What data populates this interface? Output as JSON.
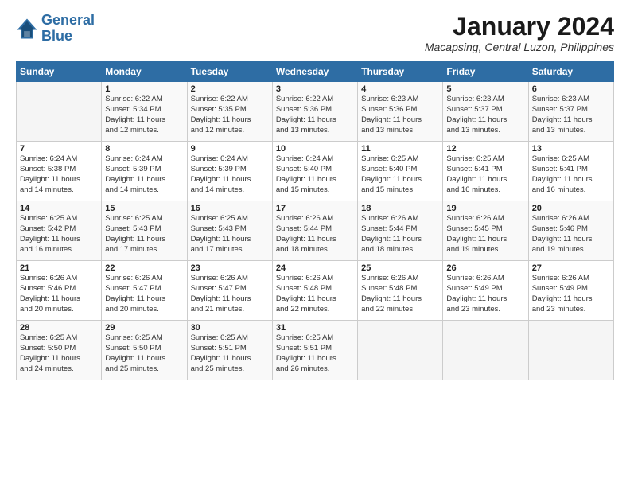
{
  "logo": {
    "line1": "General",
    "line2": "Blue"
  },
  "title": "January 2024",
  "subtitle": "Macapsing, Central Luzon, Philippines",
  "days_header": [
    "Sunday",
    "Monday",
    "Tuesday",
    "Wednesday",
    "Thursday",
    "Friday",
    "Saturday"
  ],
  "weeks": [
    [
      {
        "num": "",
        "info": ""
      },
      {
        "num": "1",
        "info": "Sunrise: 6:22 AM\nSunset: 5:34 PM\nDaylight: 11 hours\nand 12 minutes."
      },
      {
        "num": "2",
        "info": "Sunrise: 6:22 AM\nSunset: 5:35 PM\nDaylight: 11 hours\nand 12 minutes."
      },
      {
        "num": "3",
        "info": "Sunrise: 6:22 AM\nSunset: 5:36 PM\nDaylight: 11 hours\nand 13 minutes."
      },
      {
        "num": "4",
        "info": "Sunrise: 6:23 AM\nSunset: 5:36 PM\nDaylight: 11 hours\nand 13 minutes."
      },
      {
        "num": "5",
        "info": "Sunrise: 6:23 AM\nSunset: 5:37 PM\nDaylight: 11 hours\nand 13 minutes."
      },
      {
        "num": "6",
        "info": "Sunrise: 6:23 AM\nSunset: 5:37 PM\nDaylight: 11 hours\nand 13 minutes."
      }
    ],
    [
      {
        "num": "7",
        "info": "Sunrise: 6:24 AM\nSunset: 5:38 PM\nDaylight: 11 hours\nand 14 minutes."
      },
      {
        "num": "8",
        "info": "Sunrise: 6:24 AM\nSunset: 5:39 PM\nDaylight: 11 hours\nand 14 minutes."
      },
      {
        "num": "9",
        "info": "Sunrise: 6:24 AM\nSunset: 5:39 PM\nDaylight: 11 hours\nand 14 minutes."
      },
      {
        "num": "10",
        "info": "Sunrise: 6:24 AM\nSunset: 5:40 PM\nDaylight: 11 hours\nand 15 minutes."
      },
      {
        "num": "11",
        "info": "Sunrise: 6:25 AM\nSunset: 5:40 PM\nDaylight: 11 hours\nand 15 minutes."
      },
      {
        "num": "12",
        "info": "Sunrise: 6:25 AM\nSunset: 5:41 PM\nDaylight: 11 hours\nand 16 minutes."
      },
      {
        "num": "13",
        "info": "Sunrise: 6:25 AM\nSunset: 5:41 PM\nDaylight: 11 hours\nand 16 minutes."
      }
    ],
    [
      {
        "num": "14",
        "info": "Sunrise: 6:25 AM\nSunset: 5:42 PM\nDaylight: 11 hours\nand 16 minutes."
      },
      {
        "num": "15",
        "info": "Sunrise: 6:25 AM\nSunset: 5:43 PM\nDaylight: 11 hours\nand 17 minutes."
      },
      {
        "num": "16",
        "info": "Sunrise: 6:25 AM\nSunset: 5:43 PM\nDaylight: 11 hours\nand 17 minutes."
      },
      {
        "num": "17",
        "info": "Sunrise: 6:26 AM\nSunset: 5:44 PM\nDaylight: 11 hours\nand 18 minutes."
      },
      {
        "num": "18",
        "info": "Sunrise: 6:26 AM\nSunset: 5:44 PM\nDaylight: 11 hours\nand 18 minutes."
      },
      {
        "num": "19",
        "info": "Sunrise: 6:26 AM\nSunset: 5:45 PM\nDaylight: 11 hours\nand 19 minutes."
      },
      {
        "num": "20",
        "info": "Sunrise: 6:26 AM\nSunset: 5:46 PM\nDaylight: 11 hours\nand 19 minutes."
      }
    ],
    [
      {
        "num": "21",
        "info": "Sunrise: 6:26 AM\nSunset: 5:46 PM\nDaylight: 11 hours\nand 20 minutes."
      },
      {
        "num": "22",
        "info": "Sunrise: 6:26 AM\nSunset: 5:47 PM\nDaylight: 11 hours\nand 20 minutes."
      },
      {
        "num": "23",
        "info": "Sunrise: 6:26 AM\nSunset: 5:47 PM\nDaylight: 11 hours\nand 21 minutes."
      },
      {
        "num": "24",
        "info": "Sunrise: 6:26 AM\nSunset: 5:48 PM\nDaylight: 11 hours\nand 22 minutes."
      },
      {
        "num": "25",
        "info": "Sunrise: 6:26 AM\nSunset: 5:48 PM\nDaylight: 11 hours\nand 22 minutes."
      },
      {
        "num": "26",
        "info": "Sunrise: 6:26 AM\nSunset: 5:49 PM\nDaylight: 11 hours\nand 23 minutes."
      },
      {
        "num": "27",
        "info": "Sunrise: 6:26 AM\nSunset: 5:49 PM\nDaylight: 11 hours\nand 23 minutes."
      }
    ],
    [
      {
        "num": "28",
        "info": "Sunrise: 6:25 AM\nSunset: 5:50 PM\nDaylight: 11 hours\nand 24 minutes."
      },
      {
        "num": "29",
        "info": "Sunrise: 6:25 AM\nSunset: 5:50 PM\nDaylight: 11 hours\nand 25 minutes."
      },
      {
        "num": "30",
        "info": "Sunrise: 6:25 AM\nSunset: 5:51 PM\nDaylight: 11 hours\nand 25 minutes."
      },
      {
        "num": "31",
        "info": "Sunrise: 6:25 AM\nSunset: 5:51 PM\nDaylight: 11 hours\nand 26 minutes."
      },
      {
        "num": "",
        "info": ""
      },
      {
        "num": "",
        "info": ""
      },
      {
        "num": "",
        "info": ""
      }
    ]
  ]
}
